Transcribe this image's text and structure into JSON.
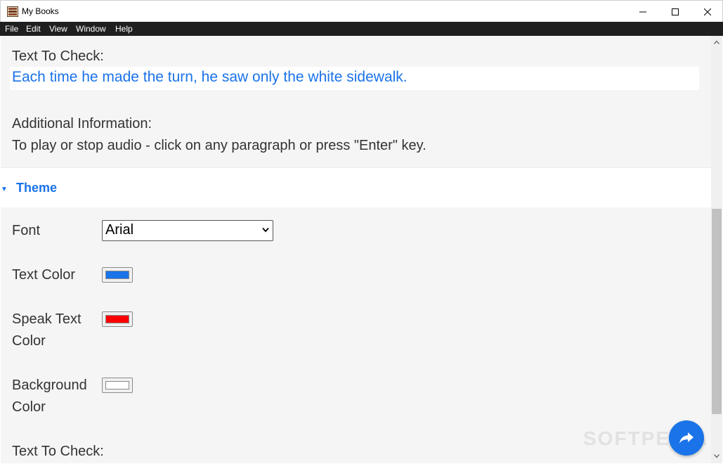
{
  "window": {
    "title": "My Books"
  },
  "menu": [
    "File",
    "Edit",
    "View",
    "Window",
    "Help"
  ],
  "main": {
    "text_to_check_label": "Text To Check:",
    "text_to_check": "Each time he made the turn, he saw only the white sidewalk.",
    "additional_info_label": "Additional Information:",
    "additional_info": "To play or stop audio - click on any paragraph or press \"Enter\" key."
  },
  "theme": {
    "title": "Theme",
    "font_label": "Font",
    "font_value": "Arial",
    "text_color_label": "Text Color",
    "text_color": "#1a73e8",
    "speak_text_color_label_1": "Speak Text",
    "speak_text_color_label_2": "Color",
    "speak_text_color": "#ff0000",
    "background_color_label_1": "Background",
    "background_color_label_2": "Color",
    "background_color": "#ffffff"
  },
  "next_section": {
    "text_to_check_label": "Text To Check:"
  },
  "fab": {
    "icon": "share-icon"
  },
  "watermark": "SOFTPEDIA"
}
